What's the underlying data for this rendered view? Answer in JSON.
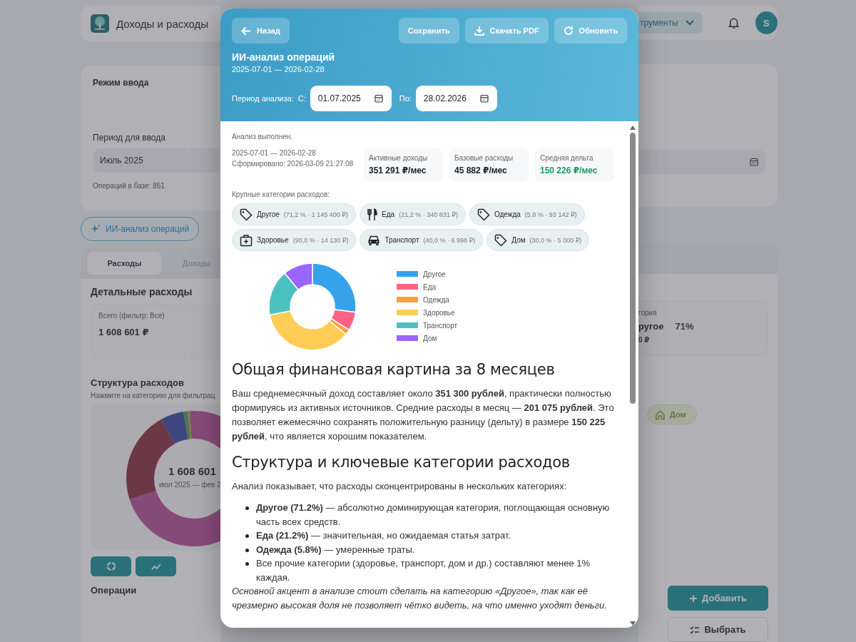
{
  "app": {
    "title": "Доходы и расходы",
    "tools_label": "трументы",
    "avatar": "S"
  },
  "input_card": {
    "mode_label": "Режим ввода",
    "period_label": "Период для ввода",
    "period_value": "Июль 2025",
    "ops_count": "Операций в базе: 851"
  },
  "ai_button": "ИИ-анализ операций",
  "tabs": [
    {
      "label": "Расходы",
      "selected": true
    },
    {
      "label": "Доходы",
      "selected": false
    }
  ],
  "details": {
    "title": "Детальные расходы",
    "total_label": "Всего (фильтр: Все)",
    "total_value": "1 608 601 ₽",
    "top_label": "гория",
    "top_name": "ругое",
    "top_share": "71%",
    "top_amount": "0 ₽"
  },
  "structure": {
    "title": "Структура расходов",
    "hint": "Нажмите на категорию для фильтрац",
    "center_value": "1 608 601",
    "center_period": "июл 2025 — фев 2",
    "chip": "Дом"
  },
  "operations_title": "Операции",
  "actions": [
    {
      "label": "Добавить"
    },
    {
      "label": "Выбрать"
    }
  ],
  "modal": {
    "back": "Назад",
    "buttons": [
      {
        "label": "Сохранить"
      },
      {
        "label": "Скачать PDF"
      },
      {
        "label": "Обновить"
      }
    ],
    "title": "ИИ-анализ операций",
    "subtitle": "2025-07-01 — 2026-02-28",
    "period_label": "Период анализа:",
    "from_label": "С:",
    "from_value": "01.07.2025",
    "to_label": "По:",
    "to_value": "28.02.2026",
    "status": "Анализ выполнен.",
    "range": "2025-07-01 — 2026-02-28",
    "generated": "Сформировано: 2026-03-09 21:27:08",
    "stats": [
      {
        "label": "Активные доходы",
        "value": "351 291 ₽/мес",
        "positive": false
      },
      {
        "label": "Базовые расходы",
        "value": "45 882 ₽/мес",
        "positive": false
      },
      {
        "label": "Средняя дельта",
        "value": "150 226 ₽/мес",
        "positive": true
      }
    ],
    "categories_label": "Крупные категории расходов:",
    "categories": [
      {
        "name": "Другое",
        "detail": "(71,2 % · 1 145 400 ₽)"
      },
      {
        "name": "Еда",
        "detail": "(21,2 % · 340 831 ₽)"
      },
      {
        "name": "Одежда",
        "detail": "(5,8 % · 93 142 ₽)"
      },
      {
        "name": "Здоровье",
        "detail": "(90,0 % · 14 130 ₽)"
      },
      {
        "name": "Транспорт",
        "detail": "(40,0 % · 6 998 ₽)"
      },
      {
        "name": "Дом",
        "detail": "(30,0 % · 5 000 ₽)"
      }
    ],
    "legend": [
      {
        "name": "Другое",
        "color": "#36a2eb"
      },
      {
        "name": "Еда",
        "color": "#ff6384"
      },
      {
        "name": "Одежда",
        "color": "#ff9f40"
      },
      {
        "name": "Здоровье",
        "color": "#ffcd56"
      },
      {
        "name": "Транспорт",
        "color": "#4bc0c0"
      },
      {
        "name": "Дом",
        "color": "#9966ff"
      }
    ],
    "report": [
      {
        "kind": "heading",
        "text": "Общая финансовая картина за 8 месяцев"
      },
      {
        "kind": "paragraph",
        "text": "Ваш среднемесячный доход составляет около **351 300 рублей**, практически полностью формируясь из активных источников. Средние расходы в месяц — **201 075 рублей**. Это позволяет ежемесячно сохранять положительную разницу (дельту) в размере **150 225 рублей**, что является хорошим показателем."
      },
      {
        "kind": "heading",
        "text": "Структура и ключевые категории расходов"
      },
      {
        "kind": "paragraph",
        "text": "Анализ показывает, что расходы сконцентрированы в нескольких категориях:"
      },
      {
        "kind": "list",
        "items": [
          "**Другое (71.2%)** — абсолютно доминирующая категория, поглощающая основную часть всех средств.",
          "**Еда (21.2%)** — значительная, но ожидаемая статья затрат.",
          "**Одежда (5.8%)** — умеренные траты.",
          "Все прочие категории (здоровье, транспорт, дом и др.) составляют менее 1% каждая."
        ]
      },
      {
        "kind": "note",
        "text": "Основной акцент в анализе стоит сделать на категорию «Другое», так как её чрезмерно высокая доля не позволяет чётко видеть, на что именно уходят деньги."
      }
    ]
  }
}
